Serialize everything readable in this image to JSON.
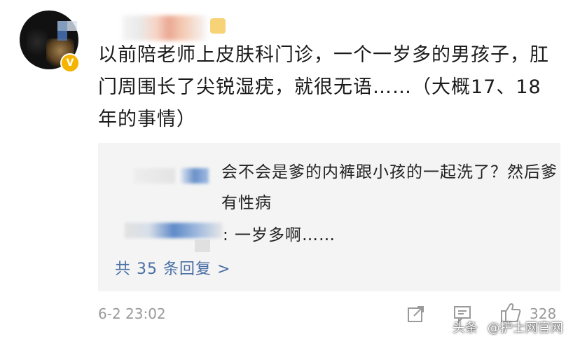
{
  "post": {
    "text": "以前陪老师上皮肤科门诊，一个一岁多的男孩子，肛门周围长了尖锐湿疣，就很无语……（大概17、18年的事情）",
    "verified_badge": "V"
  },
  "replies": [
    {
      "text": "会不会是爹的内裤跟小孩的一起洗了？然后爹有性病"
    },
    {
      "text": ": 一岁多啊……"
    }
  ],
  "more_replies_label": "共 35 条回复 >",
  "footer": {
    "timestamp": "6-2 23:02",
    "like_count": "328"
  },
  "watermark": {
    "platform": "头条",
    "account": "@护士网官网"
  }
}
